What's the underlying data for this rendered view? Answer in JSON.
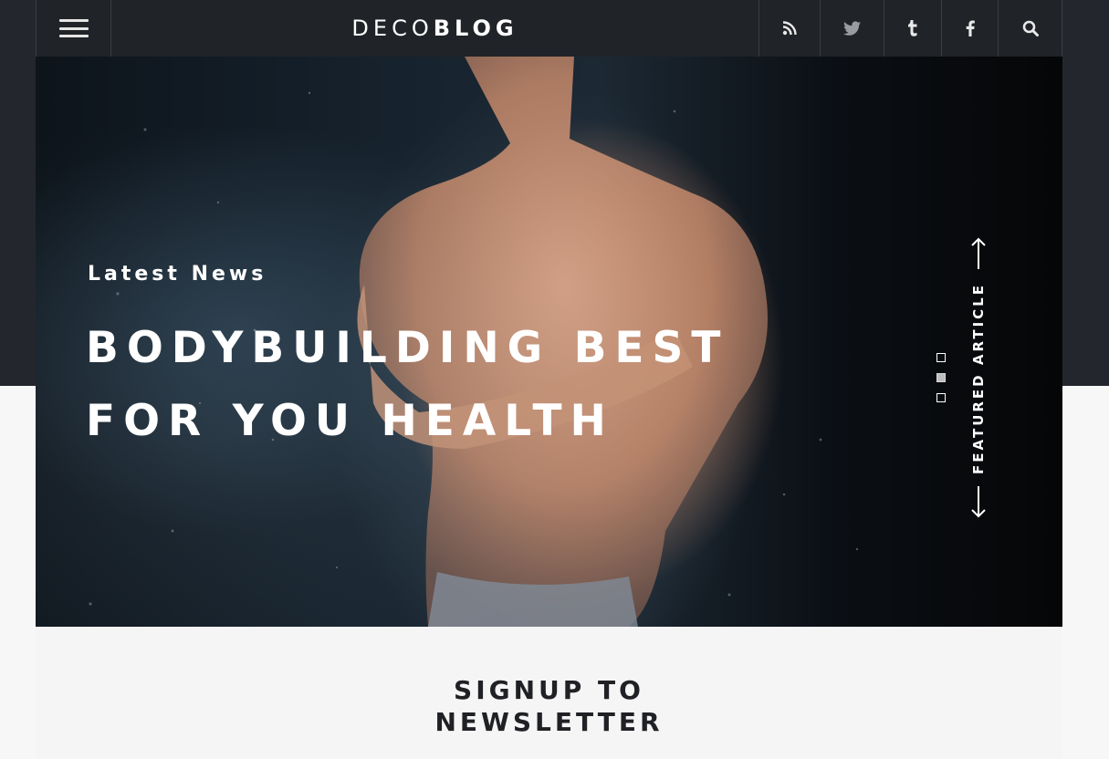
{
  "header": {
    "logo_light": "DECO",
    "logo_bold": "BLOG",
    "social": [
      {
        "icon": "rss-icon",
        "label": "RSS"
      },
      {
        "icon": "twitter-icon",
        "label": "Twitter"
      },
      {
        "icon": "tumblr-icon",
        "label": "Tumblr"
      },
      {
        "icon": "facebook-icon",
        "label": "Facebook"
      },
      {
        "icon": "search-icon",
        "label": "Search"
      }
    ]
  },
  "hero": {
    "kicker": "Latest News",
    "title_line1": "BODYBUILDING BEST",
    "title_line2": "FOR YOU HEALTH",
    "side_label": "FEATURED ARTICLE",
    "slides": 3,
    "active_slide": 2
  },
  "newsletter": {
    "title_line1": "SIGNUP TO",
    "title_line2": "NEWSLETTER"
  },
  "colors": {
    "header_bg": "#202327",
    "band_bg": "#23272d",
    "page_bg": "#f7f7f8",
    "text_dark": "#202124"
  }
}
